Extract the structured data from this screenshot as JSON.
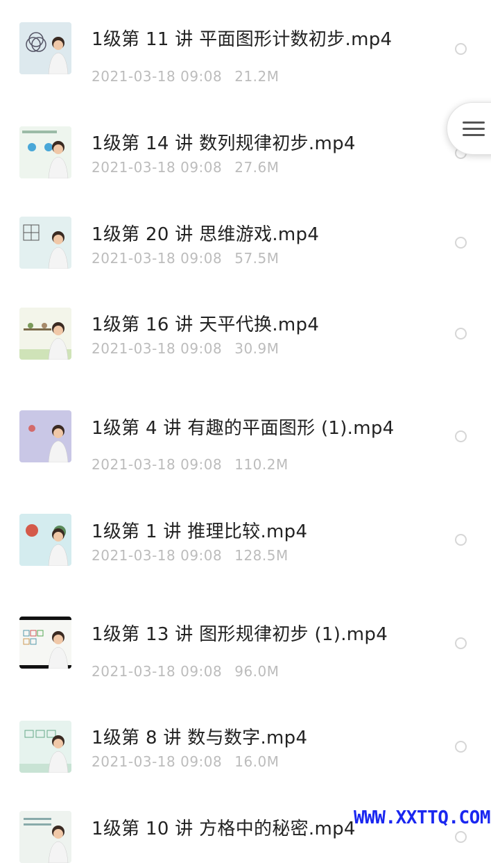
{
  "files": [
    {
      "title": "1级第 11 讲 平面图形计数初步.mp4",
      "date": "2021-03-18 09:08",
      "size": "21.2M",
      "thumb": "circles-teacher"
    },
    {
      "title": "1级第 14 讲 数列规律初步.mp4",
      "date": "2021-03-18 09:08",
      "size": "27.6M",
      "thumb": "flowers-teacher"
    },
    {
      "title": "1级第 20 讲 思维游戏.mp4",
      "date": "2021-03-18 09:08",
      "size": "57.5M",
      "thumb": "grid-teacher"
    },
    {
      "title": "1级第 16 讲 天平代换.mp4",
      "date": "2021-03-18 09:08",
      "size": "30.9M",
      "thumb": "balance-teacher"
    },
    {
      "title": "1级第 4 讲 有趣的平面图形 (1).mp4",
      "date": "2021-03-18 09:08",
      "size": "110.2M",
      "thumb": "purple-teacher"
    },
    {
      "title": "1级第 1 讲 推理比较.mp4",
      "date": "2021-03-18 09:08",
      "size": "128.5M",
      "thumb": "cartoon-teacher"
    },
    {
      "title": "1级第 13 讲 图形规律初步 (1).mp4",
      "date": "2021-03-18 09:08",
      "size": "96.0M",
      "thumb": "pattern-teacher"
    },
    {
      "title": "1级第 8 讲 数与数字.mp4",
      "date": "2021-03-18 09:08",
      "size": "16.0M",
      "thumb": "numbers-teacher"
    },
    {
      "title": "1级第 10 讲 方格中的秘密.mp4",
      "date": "",
      "size": "",
      "thumb": "squares-teacher"
    }
  ],
  "floating_menu": {
    "icon": "menu-icon"
  },
  "watermark": "WWW.XXTTQ.COM",
  "colors": {
    "title": "#222222",
    "meta": "#bcbcbc",
    "radio": "#d6d6d6",
    "watermark": "#1a27f0"
  }
}
